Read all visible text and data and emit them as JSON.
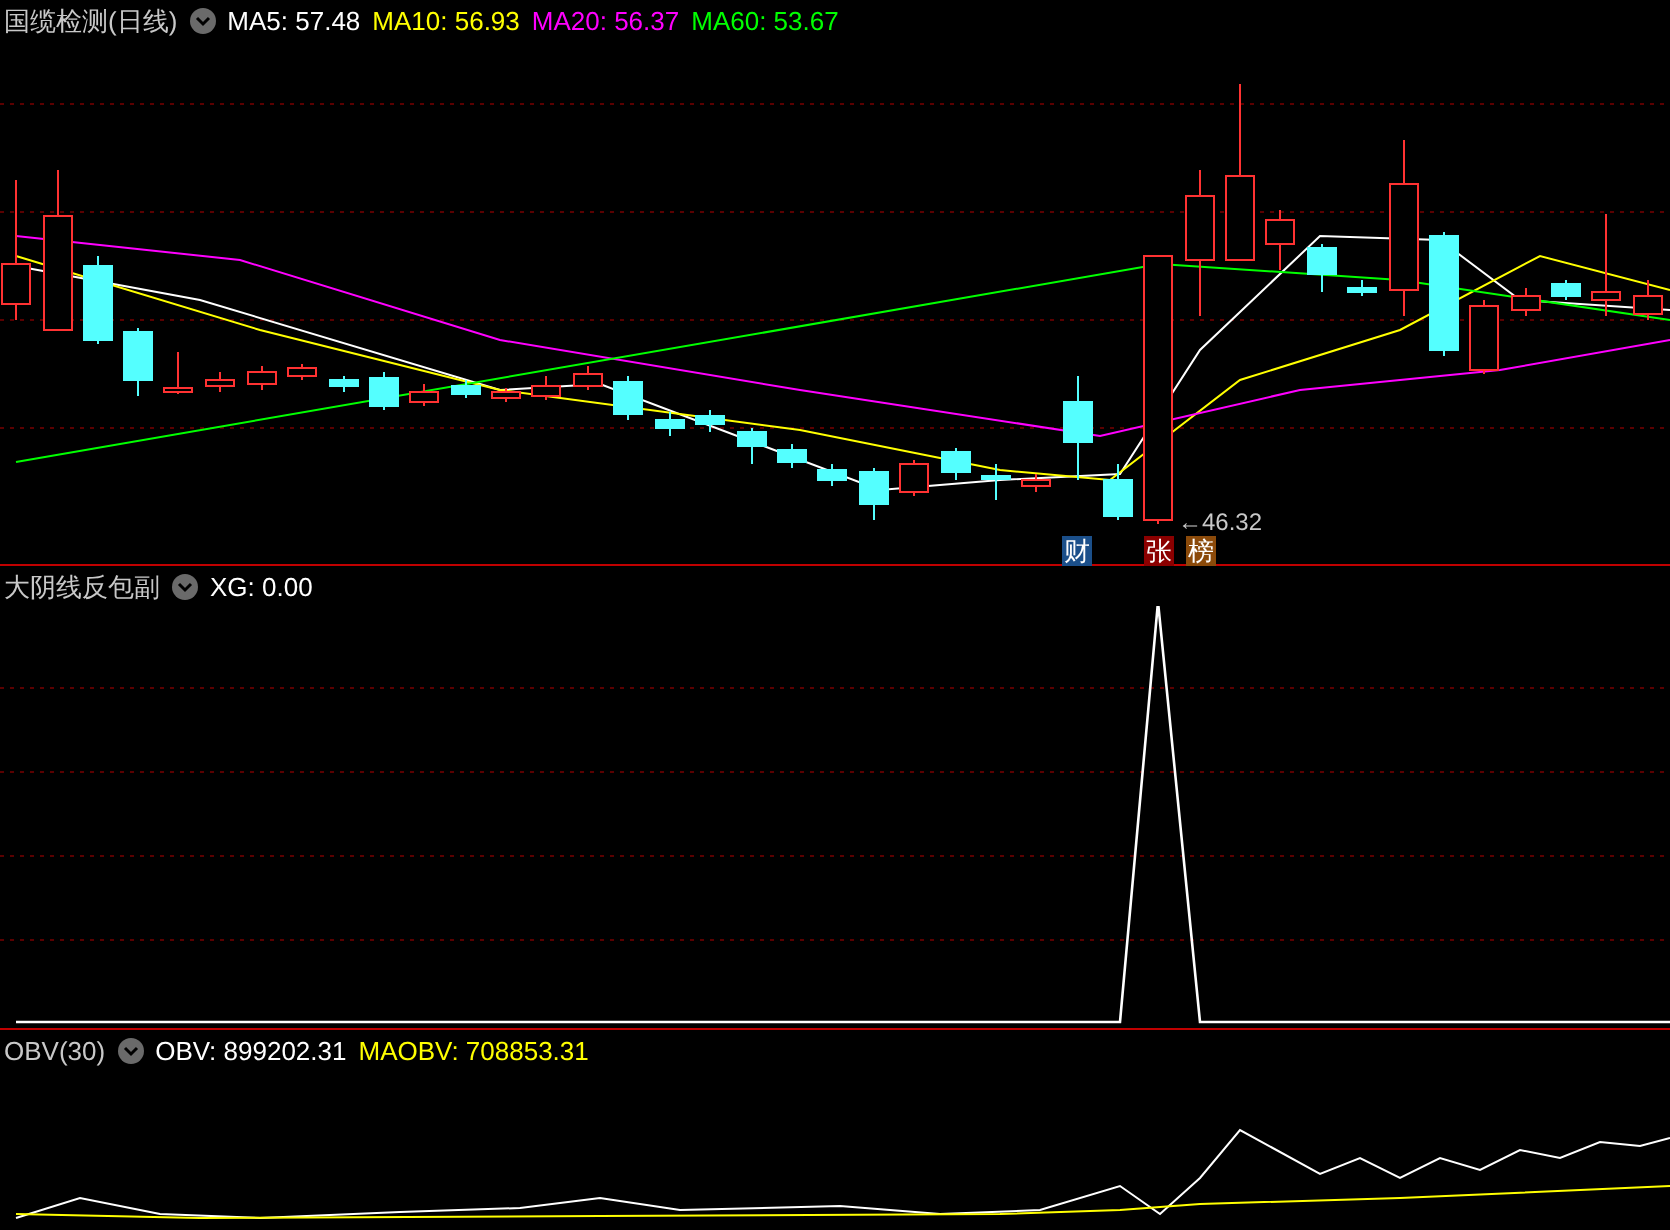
{
  "main_panel": {
    "title": "国缆检测(日线)",
    "indicators": [
      {
        "label": "MA5: 57.48",
        "color": "#ffffff"
      },
      {
        "label": "MA10: 56.93",
        "color": "#ffff00"
      },
      {
        "label": "MA20: 56.37",
        "color": "#ff00ff"
      },
      {
        "label": "MA60: 53.67",
        "color": "#00ff00"
      }
    ],
    "low_marker": "←46.32",
    "badges": [
      {
        "text": "财",
        "color": "#1b4f8a"
      },
      {
        "text": "张",
        "color": "#8b0000"
      },
      {
        "text": "榜",
        "color": "#8b4a0a"
      }
    ]
  },
  "signal_panel": {
    "title": "大阴线反包副",
    "indicators": [
      {
        "label": "XG: 0.00",
        "color": "#ffffff"
      }
    ]
  },
  "obv_panel": {
    "title": "OBV(30)",
    "indicators": [
      {
        "label": "OBV: 899202.31",
        "color": "#ffffff"
      },
      {
        "label": "MAOBV: 708853.31",
        "color": "#ffff00"
      }
    ]
  }
}
